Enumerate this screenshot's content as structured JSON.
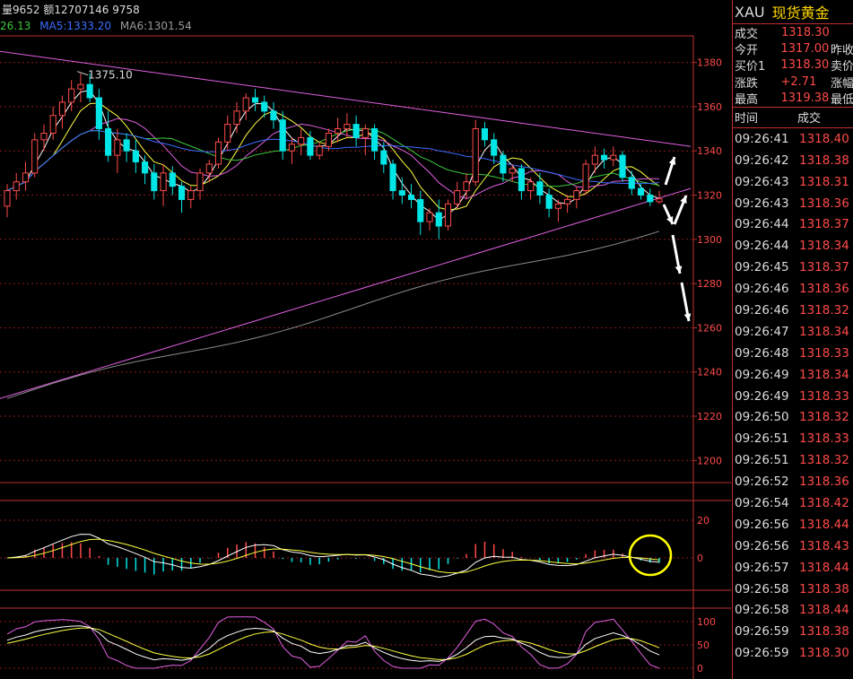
{
  "header": {
    "volume_info": "量9652 额12707146 9758",
    "ma_values": [
      {
        "label": "26.13",
        "color": "#3cc83c"
      },
      {
        "label": "MA5:1333.20",
        "color": "#3a6cff"
      },
      {
        "label": "MA6:1301.54",
        "color": "#9a9a9a"
      }
    ],
    "high_label": "1375.10"
  },
  "chart_data": {
    "type": "candlestick",
    "main_y_ticks": [
      1380,
      1360,
      1340,
      1320,
      1300,
      1280,
      1260,
      1240,
      1220,
      1200
    ],
    "main_ylim": [
      1190,
      1392
    ],
    "high_point": 1375.1,
    "candles": [
      [
        1315,
        1325,
        1310,
        1322
      ],
      [
        1322,
        1330,
        1318,
        1326
      ],
      [
        1326,
        1335,
        1322,
        1330
      ],
      [
        1330,
        1348,
        1328,
        1345
      ],
      [
        1345,
        1352,
        1340,
        1348
      ],
      [
        1348,
        1360,
        1345,
        1356
      ],
      [
        1356,
        1365,
        1350,
        1362
      ],
      [
        1362,
        1372,
        1358,
        1368
      ],
      [
        1368,
        1375,
        1362,
        1370
      ],
      [
        1370,
        1375.1,
        1362,
        1364
      ],
      [
        1364,
        1368,
        1345,
        1350
      ],
      [
        1350,
        1358,
        1335,
        1338
      ],
      [
        1338,
        1350,
        1330,
        1345
      ],
      [
        1345,
        1348,
        1335,
        1340
      ],
      [
        1340,
        1345,
        1330,
        1335
      ],
      [
        1335,
        1338,
        1325,
        1330
      ],
      [
        1330,
        1334,
        1318,
        1322
      ],
      [
        1322,
        1334,
        1315,
        1330
      ],
      [
        1330,
        1333,
        1320,
        1324
      ],
      [
        1324,
        1326,
        1312,
        1318
      ],
      [
        1318,
        1324,
        1314,
        1322
      ],
      [
        1322,
        1332,
        1318,
        1330
      ],
      [
        1330,
        1336,
        1326,
        1334
      ],
      [
        1334,
        1346,
        1332,
        1344
      ],
      [
        1344,
        1356,
        1340,
        1352
      ],
      [
        1352,
        1362,
        1348,
        1358
      ],
      [
        1358,
        1366,
        1354,
        1364
      ],
      [
        1364,
        1368,
        1358,
        1362
      ],
      [
        1362,
        1365,
        1355,
        1358
      ],
      [
        1358,
        1362,
        1350,
        1354
      ],
      [
        1354,
        1358,
        1336,
        1340
      ],
      [
        1340,
        1346,
        1334,
        1343
      ],
      [
        1343,
        1350,
        1338,
        1346
      ],
      [
        1346,
        1349,
        1336,
        1338
      ],
      [
        1338,
        1344,
        1336,
        1342
      ],
      [
        1342,
        1350,
        1340,
        1348
      ],
      [
        1348,
        1355,
        1344,
        1350
      ],
      [
        1350,
        1357,
        1346,
        1352
      ],
      [
        1352,
        1356,
        1342,
        1346
      ],
      [
        1346,
        1352,
        1338,
        1350
      ],
      [
        1350,
        1352,
        1336,
        1340
      ],
      [
        1340,
        1344,
        1330,
        1334
      ],
      [
        1334,
        1336,
        1318,
        1322
      ],
      [
        1322,
        1328,
        1316,
        1320
      ],
      [
        1320,
        1325,
        1314,
        1318
      ],
      [
        1318,
        1322,
        1302,
        1308
      ],
      [
        1308,
        1314,
        1304,
        1312
      ],
      [
        1312,
        1318,
        1300,
        1306
      ],
      [
        1306,
        1318,
        1304,
        1316
      ],
      [
        1316,
        1326,
        1314,
        1322
      ],
      [
        1322,
        1330,
        1318,
        1326
      ],
      [
        1326,
        1354,
        1324,
        1350
      ],
      [
        1350,
        1353,
        1342,
        1345
      ],
      [
        1345,
        1348,
        1334,
        1338
      ],
      [
        1338,
        1340,
        1326,
        1330
      ],
      [
        1330,
        1334,
        1326,
        1332
      ],
      [
        1332,
        1334,
        1318,
        1322
      ],
      [
        1322,
        1328,
        1318,
        1326
      ],
      [
        1326,
        1330,
        1316,
        1320
      ],
      [
        1320,
        1323,
        1310,
        1314
      ],
      [
        1314,
        1318,
        1308,
        1316
      ],
      [
        1316,
        1320,
        1312,
        1318
      ],
      [
        1318,
        1324,
        1314,
        1322
      ],
      [
        1322,
        1336,
        1320,
        1334
      ],
      [
        1334,
        1342,
        1330,
        1338
      ],
      [
        1338,
        1341,
        1332,
        1336
      ],
      [
        1336,
        1342,
        1333,
        1338
      ],
      [
        1338,
        1340,
        1326,
        1328
      ],
      [
        1328,
        1331,
        1320,
        1323
      ],
      [
        1323,
        1325,
        1318,
        1320
      ],
      [
        1320,
        1323,
        1315,
        1317
      ],
      [
        1317,
        1322,
        1316,
        1318.3
      ]
    ],
    "macd_y_ticks": [
      20,
      0
    ],
    "kdj_y_ticks": [
      100,
      50,
      0
    ]
  },
  "quote": {
    "code": "XAU",
    "name": "现货黄金",
    "rows": [
      {
        "label": "成交",
        "value": "1318.30",
        "label2": ""
      },
      {
        "label": "今开",
        "value": "1317.00",
        "label2": "昨收"
      },
      {
        "label": "买价1",
        "value": "1318.30",
        "label2": "卖价"
      },
      {
        "label": "涨跌",
        "value": "+2.71",
        "label2": "涨幅"
      },
      {
        "label": "最高",
        "value": "1319.38",
        "label2": "最低"
      }
    ]
  },
  "ticks": {
    "header_time": "时间",
    "header_price": "成交",
    "rows": [
      {
        "time": "09:26:41",
        "price": "1318.40"
      },
      {
        "time": "09:26:42",
        "price": "1318.38"
      },
      {
        "time": "09:26:43",
        "price": "1318.31"
      },
      {
        "time": "09:26:43",
        "price": "1318.36"
      },
      {
        "time": "09:26:44",
        "price": "1318.37"
      },
      {
        "time": "09:26:44",
        "price": "1318.34"
      },
      {
        "time": "09:26:45",
        "price": "1318.37"
      },
      {
        "time": "09:26:46",
        "price": "1318.36"
      },
      {
        "time": "09:26:46",
        "price": "1318.32"
      },
      {
        "time": "09:26:47",
        "price": "1318.34"
      },
      {
        "time": "09:26:48",
        "price": "1318.33"
      },
      {
        "time": "09:26:49",
        "price": "1318.34"
      },
      {
        "time": "09:26:49",
        "price": "1318.33"
      },
      {
        "time": "09:26:50",
        "price": "1318.32"
      },
      {
        "time": "09:26:51",
        "price": "1318.33"
      },
      {
        "time": "09:26:51",
        "price": "1318.32"
      },
      {
        "time": "09:26:52",
        "price": "1318.36"
      },
      {
        "time": "09:26:54",
        "price": "1318.42"
      },
      {
        "time": "09:26:56",
        "price": "1318.44"
      },
      {
        "time": "09:26:56",
        "price": "1318.43"
      },
      {
        "time": "09:26:57",
        "price": "1318.44"
      },
      {
        "time": "09:26:58",
        "price": "1318.38"
      },
      {
        "time": "09:26:58",
        "price": "1318.44"
      },
      {
        "time": "09:26:59",
        "price": "1318.38"
      },
      {
        "time": "09:26:59",
        "price": "1318.30"
      }
    ]
  },
  "colors": {
    "up": "#ff4a4a",
    "down": "#00e5e5",
    "grid": "#8a1a1a",
    "border": "#c03030",
    "trendline": "#e060e0"
  }
}
